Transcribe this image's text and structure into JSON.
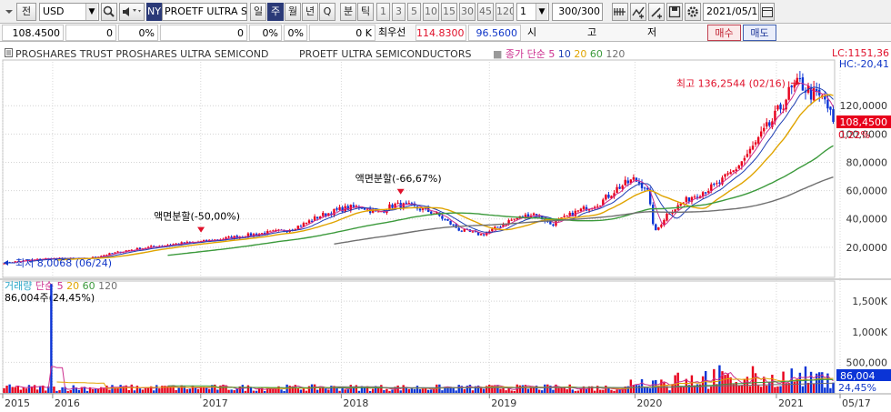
{
  "toolbar": {
    "prefix": "전",
    "currency": "USD",
    "exchange_badge": "NY",
    "symbol": "PROETF ULTRA SE",
    "periods": [
      "일",
      "주",
      "월",
      "년",
      "Q"
    ],
    "active_period": "주",
    "minute_label": "분",
    "tick_label": "틱",
    "minute_values": [
      "1",
      "3",
      "5",
      "10",
      "15",
      "30",
      "45",
      "120"
    ],
    "step_value": "1",
    "count": "300/300",
    "date": "2021/05/17"
  },
  "info": {
    "price": "108.4500",
    "change": "0",
    "change_pct": "0%",
    "volume_pct": "0%",
    "volume": "0 K",
    "best_label": "최우선",
    "best_bid": "114.8300",
    "best_ask": "96.5600",
    "col_si": "시",
    "col_go": "고",
    "col_jeo": "저",
    "buy_label": "매수",
    "sell_label": "매도"
  },
  "chart_data": {
    "type": "candlestick",
    "title": "PROSHARES TRUST PROSHARES ULTRA SEMICOND",
    "subtitle": "PROETF ULTRA SEMICONDUCTORS",
    "price_legend": [
      {
        "text": "종가 단순",
        "color": "#cc2e8e"
      },
      {
        "text": "5",
        "color": "#cc2e8e"
      },
      {
        "text": "10",
        "color": "#1f3fb4"
      },
      {
        "text": "20",
        "color": "#e0a400"
      },
      {
        "text": "60",
        "color": "#3c9a3c"
      },
      {
        "text": "120",
        "color": "#707070"
      }
    ],
    "y_ticks": [
      20,
      40,
      60,
      80,
      100,
      120
    ],
    "y_tick_labels": [
      "20,0000",
      "40,0000",
      "60,0000",
      "80,0000",
      "100,0000",
      "120,0000"
    ],
    "y_range": [
      0,
      151
    ],
    "x_tick_labels": [
      "2015",
      "2016",
      "2017",
      "2018",
      "2019",
      "2020",
      "2021",
      "05/17"
    ],
    "x_tick_positions": [
      0.0,
      0.06,
      0.238,
      0.407,
      0.585,
      0.76,
      0.93,
      1.0
    ],
    "close_anchors": [
      [
        0,
        9
      ],
      [
        0.05,
        12
      ],
      [
        0.1,
        12
      ],
      [
        0.15,
        18
      ],
      [
        0.2,
        22
      ],
      [
        0.238,
        24
      ],
      [
        0.3,
        29
      ],
      [
        0.34,
        32
      ],
      [
        0.36,
        36
      ],
      [
        0.38,
        42
      ],
      [
        0.407,
        47
      ],
      [
        0.43,
        49
      ],
      [
        0.45,
        44
      ],
      [
        0.47,
        50
      ],
      [
        0.49,
        49
      ],
      [
        0.52,
        44
      ],
      [
        0.55,
        32
      ],
      [
        0.575,
        29
      ],
      [
        0.585,
        31
      ],
      [
        0.61,
        39
      ],
      [
        0.64,
        44
      ],
      [
        0.66,
        36
      ],
      [
        0.69,
        45
      ],
      [
        0.72,
        52
      ],
      [
        0.74,
        62
      ],
      [
        0.76,
        68
      ],
      [
        0.775,
        62
      ],
      [
        0.785,
        30
      ],
      [
        0.8,
        44
      ],
      [
        0.83,
        56
      ],
      [
        0.86,
        64
      ],
      [
        0.88,
        74
      ],
      [
        0.9,
        88
      ],
      [
        0.915,
        100
      ],
      [
        0.93,
        112
      ],
      [
        0.945,
        128
      ],
      [
        0.96,
        136
      ],
      [
        0.975,
        128
      ],
      [
        0.99,
        124
      ],
      [
        1.0,
        108
      ]
    ],
    "annotations": [
      {
        "text": "최고 136,2544 (02/16)",
        "color": "#e0102a"
      },
      {
        "text": "최저 8,0068 (06/24)",
        "color": "#1036c8"
      },
      {
        "text": "액면분할(-50,00%)",
        "color": "#000000"
      },
      {
        "text": "액면분할(-66,67%)",
        "color": "#000000"
      }
    ],
    "right_labels": {
      "lc": "LC:1151,36",
      "hc": "HC:-20,41",
      "price": "108,4500",
      "pct": "0,22%"
    },
    "volume_legend": [
      {
        "text": "거래량",
        "color": "#2aa6c8"
      },
      {
        "text": "단순",
        "color": "#cc2e8e"
      },
      {
        "text": "5",
        "color": "#cc2e8e"
      },
      {
        "text": "20",
        "color": "#e0a400"
      },
      {
        "text": "60",
        "color": "#3c9a3c"
      },
      {
        "text": "120",
        "color": "#707070"
      }
    ],
    "volume_note": "86,004주(24,45%)",
    "volume_ticks": [
      500000,
      1000000,
      1500000
    ],
    "volume_tick_labels": [
      "500,000",
      "1,000K",
      "1,500K"
    ],
    "volume_range": [
      0,
      1800000
    ],
    "volume_right": {
      "value": "86,004",
      "pct": "24,45%"
    }
  }
}
